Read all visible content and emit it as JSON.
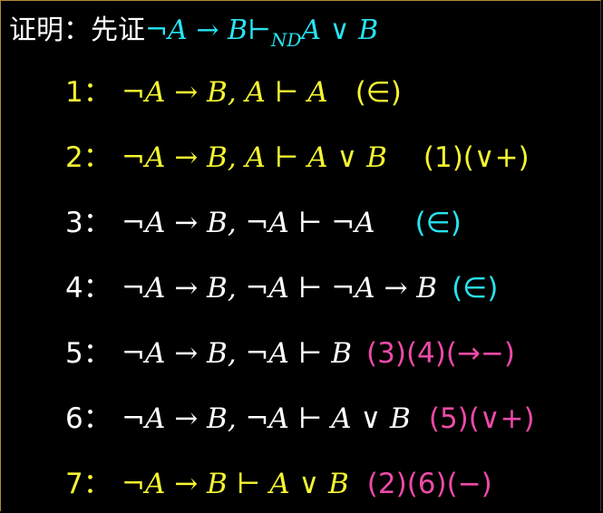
{
  "colors": {
    "background": "#000000",
    "white": "#ffffff",
    "yellow": "#f5f532",
    "cyan": "#27e4f0",
    "pink": "#ee4aa8"
  },
  "title": {
    "label": "证明：先证",
    "neg": "¬",
    "A": "A",
    "arrow": " → ",
    "B": "B",
    "turnstile": "⊢",
    "sub": "ND",
    "A2": "A",
    "or": " ∨ ",
    "B2": "B"
  },
  "steps": [
    {
      "num": "1：",
      "lhs": "¬A → B, A ⊢ ",
      "rhs": "A",
      "just": "(∈)",
      "num_color": "yellow",
      "formula_color": "yellow",
      "just_color": "yellow"
    },
    {
      "num": "2：",
      "lhs": "¬A → B, A ⊢ ",
      "rhs": "A ∨ B",
      "just": "(1)(∨+)",
      "num_color": "yellow",
      "formula_color": "yellow",
      "just_color": "yellow"
    },
    {
      "num": "3：",
      "lhs": "¬A → B, ¬A ⊢ ",
      "rhs": "¬A",
      "just": "(∈)",
      "num_color": "white",
      "formula_color": "white",
      "just_color": "cyan"
    },
    {
      "num": "4：",
      "lhs": "¬A → B, ¬A ⊢ ",
      "rhs": "¬A → B",
      "just": "(∈)",
      "num_color": "white",
      "formula_color": "white",
      "just_color": "cyan"
    },
    {
      "num": "5：",
      "lhs": "¬A → B, ¬A ⊢ ",
      "rhs": "B",
      "just": "(3)(4)(→−)",
      "num_color": "white",
      "formula_color": "white",
      "just_color": "pink"
    },
    {
      "num": "6：",
      "lhs": "¬A → B, ¬A ⊢ ",
      "rhs": "A ∨ B",
      "just": "(5)(∨+)",
      "num_color": "white",
      "formula_color": "white",
      "just_color": "pink"
    },
    {
      "num": "7：",
      "lhs": "¬A → B ⊢ ",
      "rhs": "A ∨ B",
      "just": "(2)(6)(−)",
      "num_color": "yellow",
      "formula_color": "yellow",
      "just_color": "pink"
    }
  ]
}
